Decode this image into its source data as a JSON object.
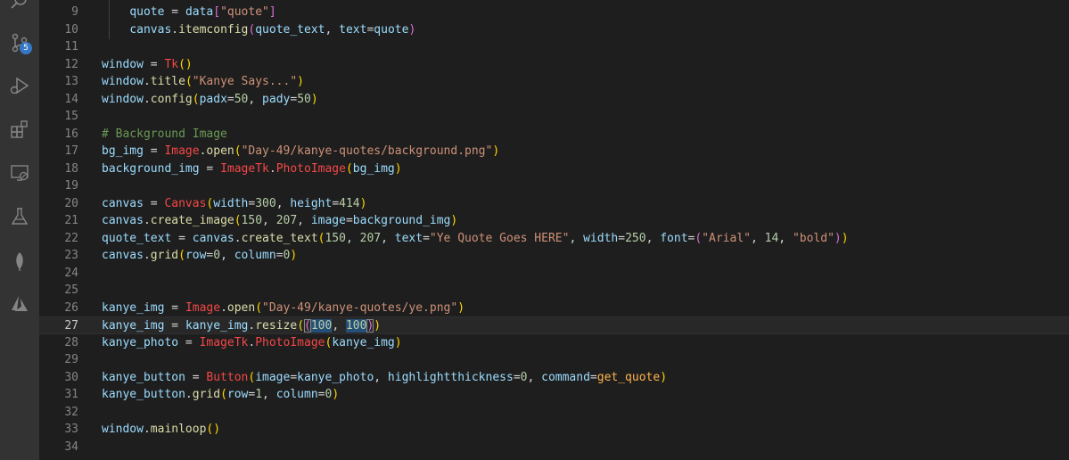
{
  "colors": {
    "variable": "#9cdcfe",
    "function": "#dcdcaa",
    "string": "#ce9178",
    "number": "#b5cea8",
    "comment": "#6a9955",
    "class": "#f44747",
    "operator": "#d4d4d4",
    "punct": "#d4d4d4",
    "paren": "#ffd700",
    "paren2": "#da70d6",
    "method": "#dcdcaa",
    "orange": "#ffb44d"
  },
  "activity_bar": {
    "source_control_badge": "5",
    "icons": [
      "search-icon",
      "source-control-icon",
      "run-debug-icon",
      "extensions-icon",
      "remote-explorer-icon",
      "testing-icon",
      "mongodb-leaf-icon",
      "azure-icon"
    ]
  },
  "editor": {
    "current_line": 27,
    "lines": [
      {
        "n": "9",
        "tokens": [
          [
            "    ",
            "punct"
          ],
          [
            "quote",
            "variable"
          ],
          [
            " = ",
            "operator"
          ],
          [
            "data",
            "variable"
          ],
          [
            "[",
            "paren2"
          ],
          [
            "\"quote\"",
            "string"
          ],
          [
            "]",
            "paren2"
          ]
        ]
      },
      {
        "n": "10",
        "tokens": [
          [
            "    ",
            "punct"
          ],
          [
            "canvas",
            "variable"
          ],
          [
            ".",
            "punct"
          ],
          [
            "itemconfig",
            "method"
          ],
          [
            "(",
            "paren2"
          ],
          [
            "quote_text",
            "variable"
          ],
          [
            ", ",
            "punct"
          ],
          [
            "text",
            "variable"
          ],
          [
            "=",
            "operator"
          ],
          [
            "quote",
            "variable"
          ],
          [
            ")",
            "paren2"
          ]
        ]
      },
      {
        "n": "11",
        "tokens": []
      },
      {
        "n": "12",
        "tokens": [
          [
            "window",
            "variable"
          ],
          [
            " = ",
            "operator"
          ],
          [
            "Tk",
            "class"
          ],
          [
            "()",
            "paren"
          ]
        ]
      },
      {
        "n": "13",
        "tokens": [
          [
            "window",
            "variable"
          ],
          [
            ".",
            "punct"
          ],
          [
            "title",
            "method"
          ],
          [
            "(",
            "paren"
          ],
          [
            "\"Kanye Says...\"",
            "string"
          ],
          [
            ")",
            "paren"
          ]
        ]
      },
      {
        "n": "14",
        "tokens": [
          [
            "window",
            "variable"
          ],
          [
            ".",
            "punct"
          ],
          [
            "config",
            "method"
          ],
          [
            "(",
            "paren"
          ],
          [
            "padx",
            "variable"
          ],
          [
            "=",
            "operator"
          ],
          [
            "50",
            "number"
          ],
          [
            ", ",
            "punct"
          ],
          [
            "pady",
            "variable"
          ],
          [
            "=",
            "operator"
          ],
          [
            "50",
            "number"
          ],
          [
            ")",
            "paren"
          ]
        ]
      },
      {
        "n": "15",
        "tokens": []
      },
      {
        "n": "16",
        "tokens": [
          [
            "# Background Image",
            "comment"
          ]
        ]
      },
      {
        "n": "17",
        "tokens": [
          [
            "bg_img",
            "variable"
          ],
          [
            " = ",
            "operator"
          ],
          [
            "Image",
            "class"
          ],
          [
            ".",
            "punct"
          ],
          [
            "open",
            "method"
          ],
          [
            "(",
            "paren"
          ],
          [
            "\"Day-49/kanye-quotes/background.png\"",
            "string"
          ],
          [
            ")",
            "paren"
          ]
        ]
      },
      {
        "n": "18",
        "tokens": [
          [
            "background_img",
            "variable"
          ],
          [
            " = ",
            "operator"
          ],
          [
            "ImageTk",
            "class"
          ],
          [
            ".",
            "punct"
          ],
          [
            "PhotoImage",
            "class"
          ],
          [
            "(",
            "paren"
          ],
          [
            "bg_img",
            "variable"
          ],
          [
            ")",
            "paren"
          ]
        ]
      },
      {
        "n": "19",
        "tokens": []
      },
      {
        "n": "20",
        "tokens": [
          [
            "canvas",
            "variable"
          ],
          [
            " = ",
            "operator"
          ],
          [
            "Canvas",
            "class"
          ],
          [
            "(",
            "paren"
          ],
          [
            "width",
            "variable"
          ],
          [
            "=",
            "operator"
          ],
          [
            "300",
            "number"
          ],
          [
            ", ",
            "punct"
          ],
          [
            "height",
            "variable"
          ],
          [
            "=",
            "operator"
          ],
          [
            "414",
            "number"
          ],
          [
            ")",
            "paren"
          ]
        ]
      },
      {
        "n": "21",
        "tokens": [
          [
            "canvas",
            "variable"
          ],
          [
            ".",
            "punct"
          ],
          [
            "create_image",
            "method"
          ],
          [
            "(",
            "paren"
          ],
          [
            "150",
            "number"
          ],
          [
            ", ",
            "punct"
          ],
          [
            "207",
            "number"
          ],
          [
            ", ",
            "punct"
          ],
          [
            "image",
            "variable"
          ],
          [
            "=",
            "operator"
          ],
          [
            "background_img",
            "variable"
          ],
          [
            ")",
            "paren"
          ]
        ]
      },
      {
        "n": "22",
        "tokens": [
          [
            "quote_text",
            "variable"
          ],
          [
            " = ",
            "operator"
          ],
          [
            "canvas",
            "variable"
          ],
          [
            ".",
            "punct"
          ],
          [
            "create_text",
            "method"
          ],
          [
            "(",
            "paren"
          ],
          [
            "150",
            "number"
          ],
          [
            ", ",
            "punct"
          ],
          [
            "207",
            "number"
          ],
          [
            ", ",
            "punct"
          ],
          [
            "text",
            "variable"
          ],
          [
            "=",
            "operator"
          ],
          [
            "\"Ye Quote Goes HERE\"",
            "string"
          ],
          [
            ", ",
            "punct"
          ],
          [
            "width",
            "variable"
          ],
          [
            "=",
            "operator"
          ],
          [
            "250",
            "number"
          ],
          [
            ", ",
            "punct"
          ],
          [
            "font",
            "variable"
          ],
          [
            "=",
            "operator"
          ],
          [
            "(",
            "paren2"
          ],
          [
            "\"Arial\"",
            "string"
          ],
          [
            ", ",
            "punct"
          ],
          [
            "14",
            "number"
          ],
          [
            ", ",
            "punct"
          ],
          [
            "\"bold\"",
            "string"
          ],
          [
            ")",
            "paren2"
          ],
          [
            ")",
            "paren"
          ]
        ]
      },
      {
        "n": "23",
        "tokens": [
          [
            "canvas",
            "variable"
          ],
          [
            ".",
            "punct"
          ],
          [
            "grid",
            "method"
          ],
          [
            "(",
            "paren"
          ],
          [
            "row",
            "variable"
          ],
          [
            "=",
            "operator"
          ],
          [
            "0",
            "number"
          ],
          [
            ", ",
            "punct"
          ],
          [
            "column",
            "variable"
          ],
          [
            "=",
            "operator"
          ],
          [
            "0",
            "number"
          ],
          [
            ")",
            "paren"
          ]
        ]
      },
      {
        "n": "24",
        "tokens": []
      },
      {
        "n": "25",
        "tokens": []
      },
      {
        "n": "26",
        "tokens": [
          [
            "kanye_img",
            "variable"
          ],
          [
            " = ",
            "operator"
          ],
          [
            "Image",
            "class"
          ],
          [
            ".",
            "punct"
          ],
          [
            "open",
            "method"
          ],
          [
            "(",
            "paren"
          ],
          [
            "\"Day-49/kanye-quotes/ye.png\"",
            "string"
          ],
          [
            ")",
            "paren"
          ]
        ]
      },
      {
        "n": "27",
        "tokens": [
          [
            "kanye_img",
            "variable"
          ],
          [
            " = ",
            "operator"
          ],
          [
            "kanye_img",
            "variable"
          ],
          [
            ".",
            "punct"
          ],
          [
            "resize",
            "method"
          ],
          [
            "(",
            "paren"
          ],
          [
            "(",
            "paren2",
            "bm"
          ],
          [
            "100",
            "number",
            "sel"
          ],
          [
            ", ",
            "punct"
          ],
          [
            "100",
            "number",
            "sel"
          ],
          [
            ")",
            "paren2",
            "bm"
          ],
          [
            ")",
            "paren"
          ]
        ]
      },
      {
        "n": "28",
        "tokens": [
          [
            "kanye_photo",
            "variable"
          ],
          [
            " = ",
            "operator"
          ],
          [
            "ImageTk",
            "class"
          ],
          [
            ".",
            "punct"
          ],
          [
            "PhotoImage",
            "class"
          ],
          [
            "(",
            "paren"
          ],
          [
            "kanye_img",
            "variable"
          ],
          [
            ")",
            "paren"
          ]
        ]
      },
      {
        "n": "29",
        "tokens": []
      },
      {
        "n": "30",
        "tokens": [
          [
            "kanye_button",
            "variable"
          ],
          [
            " = ",
            "operator"
          ],
          [
            "Button",
            "class"
          ],
          [
            "(",
            "paren"
          ],
          [
            "image",
            "variable"
          ],
          [
            "=",
            "operator"
          ],
          [
            "kanye_photo",
            "variable"
          ],
          [
            ", ",
            "punct"
          ],
          [
            "highlightthickness",
            "variable"
          ],
          [
            "=",
            "operator"
          ],
          [
            "0",
            "number"
          ],
          [
            ", ",
            "punct"
          ],
          [
            "command",
            "variable"
          ],
          [
            "=",
            "operator"
          ],
          [
            "get_quote",
            "orange"
          ],
          [
            ")",
            "paren"
          ]
        ]
      },
      {
        "n": "31",
        "tokens": [
          [
            "kanye_button",
            "variable"
          ],
          [
            ".",
            "punct"
          ],
          [
            "grid",
            "method"
          ],
          [
            "(",
            "paren"
          ],
          [
            "row",
            "variable"
          ],
          [
            "=",
            "operator"
          ],
          [
            "1",
            "number"
          ],
          [
            ", ",
            "punct"
          ],
          [
            "column",
            "variable"
          ],
          [
            "=",
            "operator"
          ],
          [
            "0",
            "number"
          ],
          [
            ")",
            "paren"
          ]
        ]
      },
      {
        "n": "32",
        "tokens": []
      },
      {
        "n": "33",
        "tokens": [
          [
            "window",
            "variable"
          ],
          [
            ".",
            "punct"
          ],
          [
            "mainloop",
            "method"
          ],
          [
            "()",
            "paren"
          ]
        ]
      },
      {
        "n": "34",
        "tokens": []
      }
    ]
  }
}
